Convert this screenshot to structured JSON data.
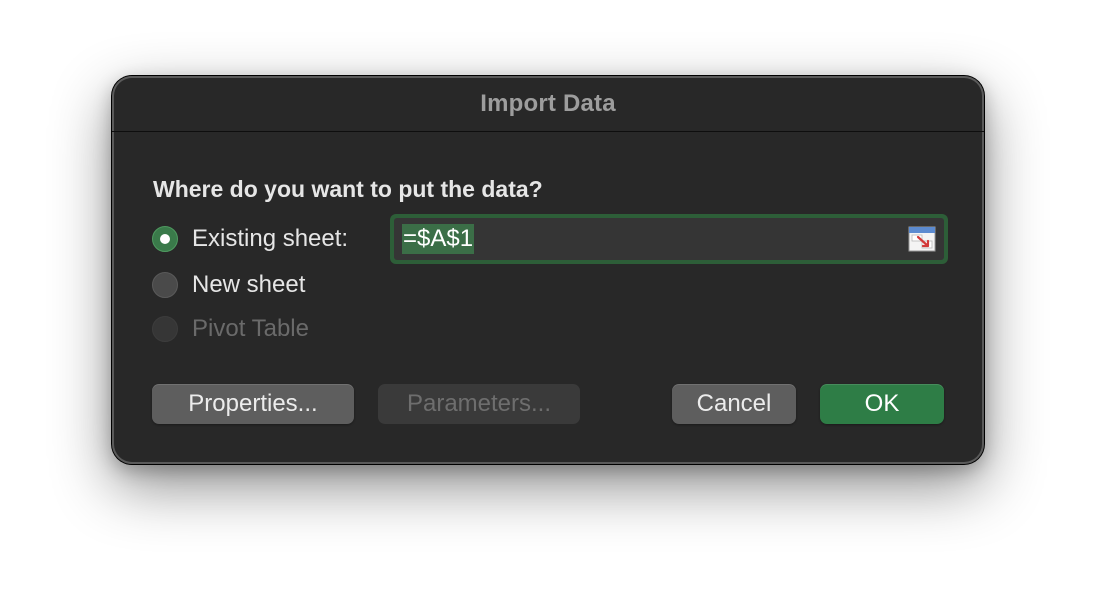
{
  "dialog": {
    "title": "Import Data",
    "question": "Where do you want to put the data?",
    "options": [
      {
        "label": "Existing sheet:",
        "selected": true,
        "enabled": true
      },
      {
        "label": "New sheet",
        "selected": false,
        "enabled": true
      },
      {
        "label": "Pivot Table",
        "selected": false,
        "enabled": false
      }
    ],
    "range_field": {
      "value": "=$A$1",
      "icon": "collapse-range-icon"
    },
    "buttons": {
      "properties": "Properties...",
      "parameters": "Parameters...",
      "cancel": "Cancel",
      "ok": "OK"
    },
    "colors": {
      "accent": "#2e7d46",
      "background": "#282828"
    }
  }
}
